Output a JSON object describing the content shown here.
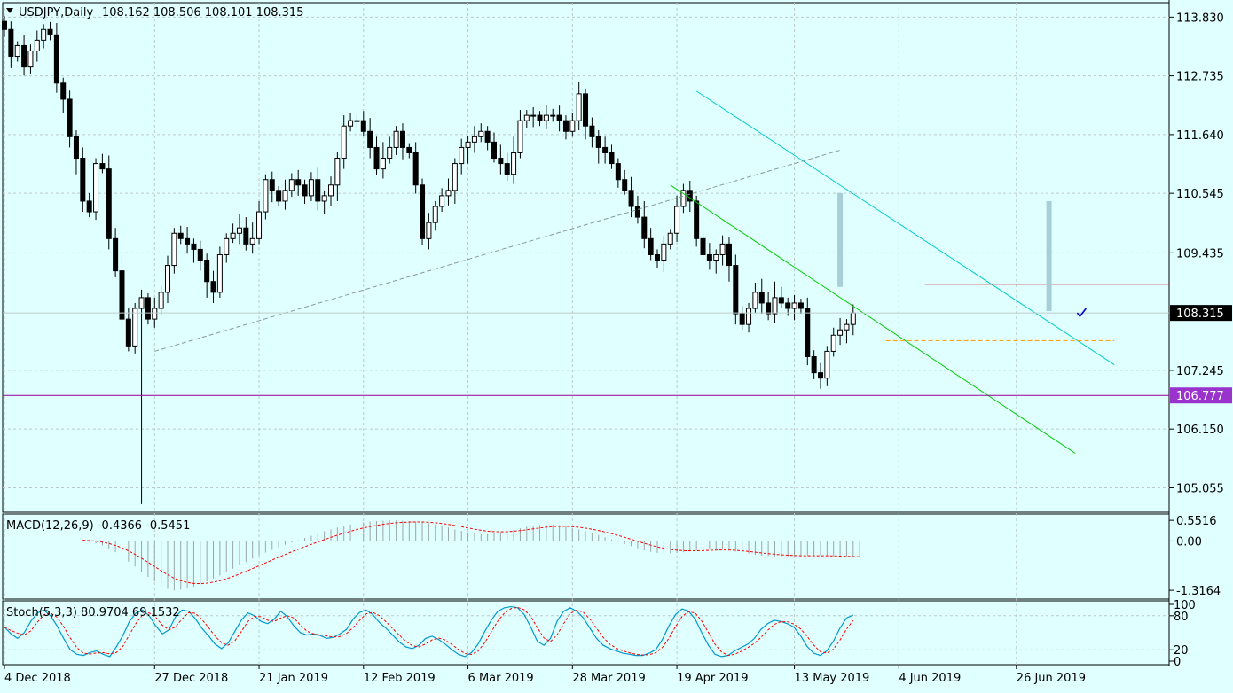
{
  "header": {
    "symbol": "USDJPY,Daily",
    "ohlc": "108.162 108.506 108.101 108.315"
  },
  "colors": {
    "background": "#e0ffff",
    "bull_candle": "#ffffff",
    "bear_candle": "#000000",
    "trend_upper": "#00cccc",
    "trend_lower": "#00cc00",
    "resistance": "#cc0000",
    "support": "#990099",
    "dashed_support": "#ff9900",
    "price_label": "#000000",
    "support_label": "#9933cc",
    "macd_signal": "#ff0000",
    "stoch_main": "#0099cc",
    "stoch_signal": "#ff0000",
    "bar_highlight": "#a8cfd8"
  },
  "chart_data": [
    {
      "type": "candlestick",
      "symbol": "USDJPY",
      "timeframe": "Daily",
      "yticks": [
        113.83,
        112.735,
        111.64,
        110.545,
        109.435,
        107.245,
        106.15,
        105.055
      ],
      "ytick_labels": [
        "113.830",
        "112.735",
        "111.640",
        "110.545",
        "109.435",
        "107.245",
        "106.150",
        "105.055"
      ],
      "ylim": [
        104.6,
        114.1
      ],
      "xtick_labels": [
        "4 Dec 2018",
        "27 Dec 2018",
        "21 Jan 2019",
        "12 Feb 2019",
        "6 Mar 2019",
        "28 Mar 2019",
        "19 Apr 2019",
        "13 May 2019",
        "4 Jun 2019",
        "26 Jun 2019"
      ],
      "xtick_bar_index": [
        0,
        23,
        39,
        55,
        71,
        87,
        103,
        121,
        137,
        155
      ],
      "current_price": 108.315,
      "current_price_label": "108.315",
      "support_level": 106.777,
      "support_label": "106.777",
      "resistance_level": 108.85,
      "dashed_level": 107.8,
      "closes": [
        113.6,
        113.1,
        113.3,
        112.9,
        113.2,
        113.4,
        113.6,
        113.5,
        112.6,
        112.3,
        111.6,
        111.2,
        110.4,
        110.2,
        111.1,
        111.0,
        109.7,
        109.1,
        108.2,
        107.7,
        108.4,
        108.6,
        108.2,
        108.4,
        108.7,
        109.2,
        109.8,
        109.7,
        109.6,
        109.5,
        109.3,
        108.9,
        108.7,
        109.4,
        109.7,
        109.8,
        109.9,
        109.6,
        109.7,
        110.2,
        110.8,
        110.6,
        110.4,
        110.6,
        110.8,
        110.7,
        110.5,
        110.8,
        110.4,
        110.5,
        110.7,
        111.2,
        111.8,
        111.9,
        111.9,
        111.7,
        111.4,
        111.0,
        111.2,
        111.4,
        111.7,
        111.4,
        111.3,
        110.7,
        109.7,
        110.0,
        110.3,
        110.5,
        110.6,
        111.1,
        111.4,
        111.5,
        111.6,
        111.7,
        111.5,
        111.2,
        111.1,
        110.9,
        111.3,
        111.9,
        112.0,
        112.0,
        111.9,
        112.0,
        112.0,
        111.9,
        111.7,
        111.9,
        112.4,
        111.8,
        111.6,
        111.4,
        111.3,
        111.1,
        110.8,
        110.6,
        110.3,
        110.1,
        109.7,
        109.4,
        109.3,
        109.6,
        109.8,
        110.3,
        110.6,
        110.4,
        109.7,
        109.4,
        109.3,
        109.4,
        109.6,
        109.2,
        108.3,
        108.1,
        108.4,
        108.7,
        108.5,
        108.3,
        108.6,
        108.5,
        108.4,
        108.5,
        108.4,
        107.5,
        107.2,
        107.1,
        107.6,
        107.9,
        108.0,
        108.1,
        108.315
      ],
      "indicators": {
        "macd": {
          "label": "MACD(12,26,9) -0.4366 -0.5451",
          "yticks": [
            0.5516,
            0.0,
            -1.3164
          ],
          "ytick_labels": [
            "0.5516",
            "0.00",
            "-1.3164"
          ],
          "ylim": [
            -1.55,
            0.72
          ],
          "histogram": [
            0.02,
            -0.02,
            -0.06,
            -0.12,
            -0.2,
            -0.3,
            -0.42,
            -0.55,
            -0.68,
            -0.82,
            -0.96,
            -1.08,
            -1.2,
            -1.28,
            -1.32,
            -1.3,
            -1.27,
            -1.22,
            -1.16,
            -1.08,
            -1.0,
            -0.92,
            -0.83,
            -0.74,
            -0.65,
            -0.56,
            -0.47,
            -0.39,
            -0.31,
            -0.24,
            -0.17,
            -0.1,
            -0.04,
            0.02,
            0.08,
            0.14,
            0.2,
            0.26,
            0.31,
            0.36,
            0.4,
            0.44,
            0.47,
            0.5,
            0.52,
            0.53,
            0.54,
            0.55,
            0.55,
            0.54,
            0.53,
            0.52,
            0.5,
            0.47,
            0.44,
            0.4,
            0.36,
            0.31,
            0.27,
            0.23,
            0.2,
            0.18,
            0.18,
            0.2,
            0.23,
            0.26,
            0.3,
            0.34,
            0.38,
            0.41,
            0.43,
            0.44,
            0.44,
            0.42,
            0.39,
            0.35,
            0.31,
            0.26,
            0.21,
            0.16,
            0.1,
            0.04,
            -0.02,
            -0.08,
            -0.14,
            -0.2,
            -0.25,
            -0.29,
            -0.32,
            -0.33,
            -0.33,
            -0.32,
            -0.3,
            -0.28,
            -0.26,
            -0.24,
            -0.22,
            -0.22,
            -0.23,
            -0.25,
            -0.28,
            -0.31,
            -0.34,
            -0.37,
            -0.39,
            -0.4,
            -0.41,
            -0.42,
            -0.42,
            -0.42,
            -0.41,
            -0.4,
            -0.39,
            -0.39,
            -0.4,
            -0.41,
            -0.42,
            -0.43,
            -0.44,
            -0.44
          ]
        },
        "stochastic": {
          "label": "Stoch(5,3,3) 80.9704 69.1532",
          "yticks": [
            100,
            80,
            20,
            0
          ],
          "ytick_labels": [
            "100",
            "80",
            "20",
            "0"
          ],
          "ylim": [
            0,
            100
          ],
          "main": [
            60,
            48,
            40,
            50,
            70,
            85,
            90,
            80,
            62,
            40,
            20,
            12,
            10,
            15,
            18,
            12,
            8,
            25,
            45,
            70,
            85,
            90,
            80,
            62,
            48,
            55,
            78,
            90,
            88,
            75,
            58,
            45,
            30,
            22,
            32,
            52,
            72,
            85,
            80,
            70,
            66,
            74,
            88,
            78,
            62,
            50,
            46,
            48,
            45,
            40,
            42,
            48,
            56,
            74,
            86,
            90,
            82,
            68,
            58,
            46,
            34,
            25,
            22,
            28,
            40,
            44,
            38,
            30,
            20,
            12,
            8,
            15,
            30,
            52,
            72,
            88,
            94,
            96,
            94,
            82,
            60,
            35,
            28,
            40,
            70,
            88,
            94,
            88,
            76,
            58,
            40,
            28,
            22,
            18,
            14,
            12,
            10,
            10,
            14,
            20,
            38,
            62,
            82,
            92,
            88,
            74,
            50,
            28,
            12,
            8,
            10,
            18,
            24,
            30,
            40,
            56,
            66,
            72,
            70,
            66,
            60,
            45,
            26,
            14,
            10,
            18,
            35,
            58,
            76,
            80.9704
          ]
        }
      }
    }
  ]
}
